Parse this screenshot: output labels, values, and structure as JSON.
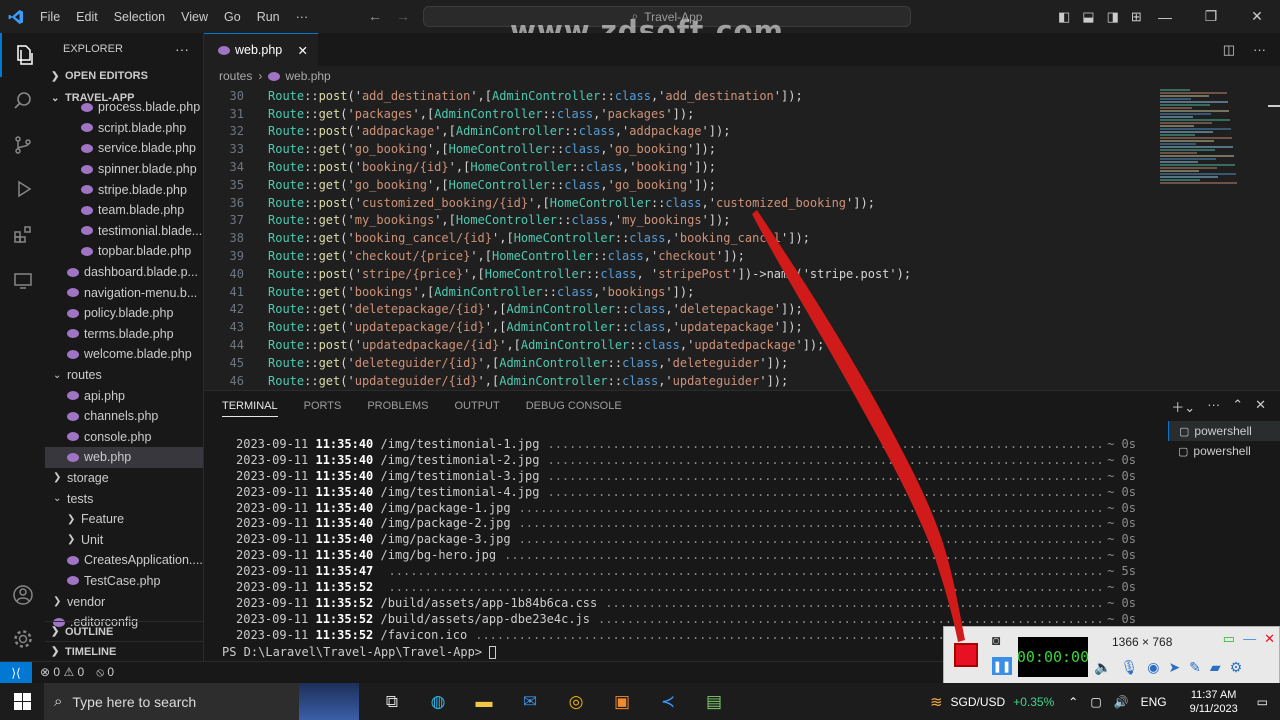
{
  "titlebar": {
    "menu": [
      "File",
      "Edit",
      "Selection",
      "View",
      "Go",
      "Run",
      "···"
    ],
    "search_text": "Travel-App",
    "watermark": "www.zdsoft.com"
  },
  "sidebar": {
    "header": "EXPLORER",
    "open_editors": "OPEN EDITORS",
    "project": "TRAVEL-APP",
    "items": [
      {
        "label": "process.blade.php",
        "indent": 2,
        "type": "file"
      },
      {
        "label": "script.blade.php",
        "indent": 2,
        "type": "file"
      },
      {
        "label": "service.blade.php",
        "indent": 2,
        "type": "file"
      },
      {
        "label": "spinner.blade.php",
        "indent": 2,
        "type": "file"
      },
      {
        "label": "stripe.blade.php",
        "indent": 2,
        "type": "file"
      },
      {
        "label": "team.blade.php",
        "indent": 2,
        "type": "file"
      },
      {
        "label": "testimonial.blade....",
        "indent": 2,
        "type": "file"
      },
      {
        "label": "topbar.blade.php",
        "indent": 2,
        "type": "file"
      },
      {
        "label": "dashboard.blade.p...",
        "indent": 1,
        "type": "file"
      },
      {
        "label": "navigation-menu.b...",
        "indent": 1,
        "type": "file"
      },
      {
        "label": "policy.blade.php",
        "indent": 1,
        "type": "file"
      },
      {
        "label": "terms.blade.php",
        "indent": 1,
        "type": "file"
      },
      {
        "label": "welcome.blade.php",
        "indent": 1,
        "type": "file"
      },
      {
        "label": "routes",
        "indent": 0,
        "type": "folder-open"
      },
      {
        "label": "api.php",
        "indent": 1,
        "type": "file"
      },
      {
        "label": "channels.php",
        "indent": 1,
        "type": "file"
      },
      {
        "label": "console.php",
        "indent": 1,
        "type": "file"
      },
      {
        "label": "web.php",
        "indent": 1,
        "type": "file",
        "selected": true
      },
      {
        "label": "storage",
        "indent": 0,
        "type": "folder"
      },
      {
        "label": "tests",
        "indent": 0,
        "type": "folder-open"
      },
      {
        "label": "Feature",
        "indent": 1,
        "type": "folder"
      },
      {
        "label": "Unit",
        "indent": 1,
        "type": "folder"
      },
      {
        "label": "CreatesApplication....",
        "indent": 1,
        "type": "file"
      },
      {
        "label": "TestCase.php",
        "indent": 1,
        "type": "file"
      },
      {
        "label": "vendor",
        "indent": 0,
        "type": "folder"
      },
      {
        "label": ".editorconfig",
        "indent": 0,
        "type": "file"
      }
    ],
    "outline": "OUTLINE",
    "timeline": "TIMELINE"
  },
  "editor": {
    "tab_label": "web.php",
    "breadcrumb": [
      "routes",
      "web.php"
    ],
    "lines": [
      {
        "n": "30",
        "m": "post",
        "path": "add_destination",
        "ctl": "AdminController",
        "act": "add_destination",
        "tail": "]);"
      },
      {
        "n": "31",
        "m": "get",
        "path": "packages",
        "ctl": "AdminController",
        "act": "packages",
        "tail": "]);"
      },
      {
        "n": "32",
        "m": "post",
        "path": "addpackage",
        "ctl": "AdminController",
        "act": "addpackage",
        "tail": "]);"
      },
      {
        "n": "33",
        "m": "get",
        "path": "go_booking",
        "ctl": "HomeController",
        "act": "go_booking",
        "tail": "]);"
      },
      {
        "n": "34",
        "m": "post",
        "path": "booking/{id}",
        "ctl": "HomeController",
        "act": "booking",
        "tail": "]);"
      },
      {
        "n": "35",
        "m": "get",
        "path": "go_booking",
        "ctl": "HomeController",
        "act": "go_booking",
        "tail": "]);"
      },
      {
        "n": "36",
        "m": "post",
        "path": "customized_booking/{id}",
        "ctl": "HomeController",
        "act": "customized_booking",
        "tail": "]);"
      },
      {
        "n": "37",
        "m": "get",
        "path": "my_bookings",
        "ctl": "HomeController",
        "act": "my_bookings",
        "tail": "]);"
      },
      {
        "n": "38",
        "m": "get",
        "path": "booking_cancel/{id}",
        "ctl": "HomeController",
        "act": "booking_cancel",
        "tail": "]);"
      },
      {
        "n": "39",
        "m": "get",
        "path": "checkout/{price}",
        "ctl": "HomeController",
        "act": "checkout",
        "tail": "]);"
      },
      {
        "n": "40",
        "m": "post",
        "path": "stripe/{price}",
        "ctl": "HomeController",
        "act": "stripePost",
        "tail": "])->name('stripe.post');",
        "space": true
      },
      {
        "n": "41",
        "m": "get",
        "path": "bookings",
        "ctl": "AdminController",
        "act": "bookings",
        "tail": "]);"
      },
      {
        "n": "42",
        "m": "get",
        "path": "deletepackage/{id}",
        "ctl": "AdminController",
        "act": "deletepackage",
        "tail": "]);"
      },
      {
        "n": "43",
        "m": "get",
        "path": "updatepackage/{id}",
        "ctl": "AdminController",
        "act": "updatepackage",
        "tail": "]);"
      },
      {
        "n": "44",
        "m": "post",
        "path": "updatedpackage/{id}",
        "ctl": "AdminController",
        "act": "updatedpackage",
        "tail": "]);"
      },
      {
        "n": "45",
        "m": "get",
        "path": "deleteguider/{id}",
        "ctl": "AdminController",
        "act": "deleteguider",
        "tail": "]);"
      },
      {
        "n": "46",
        "m": "get",
        "path": "updateguider/{id}",
        "ctl": "AdminController",
        "act": "updateguider",
        "tail": "]);"
      }
    ]
  },
  "panel": {
    "tabs": [
      "TERMINAL",
      "PORTS",
      "PROBLEMS",
      "OUTPUT",
      "DEBUG CONSOLE"
    ],
    "log": [
      {
        "date": "2023-09-11",
        "time": "11:35:40",
        "path": "/img/testimonial-1.jpg",
        "dur": "~ 0s"
      },
      {
        "date": "2023-09-11",
        "time": "11:35:40",
        "path": "/img/testimonial-2.jpg",
        "dur": "~ 0s"
      },
      {
        "date": "2023-09-11",
        "time": "11:35:40",
        "path": "/img/testimonial-3.jpg",
        "dur": "~ 0s"
      },
      {
        "date": "2023-09-11",
        "time": "11:35:40",
        "path": "/img/testimonial-4.jpg",
        "dur": "~ 0s"
      },
      {
        "date": "2023-09-11",
        "time": "11:35:40",
        "path": "/img/package-1.jpg",
        "dur": "~ 0s"
      },
      {
        "date": "2023-09-11",
        "time": "11:35:40",
        "path": "/img/package-2.jpg",
        "dur": "~ 0s"
      },
      {
        "date": "2023-09-11",
        "time": "11:35:40",
        "path": "/img/package-3.jpg",
        "dur": "~ 0s"
      },
      {
        "date": "2023-09-11",
        "time": "11:35:40",
        "path": "/img/bg-hero.jpg",
        "dur": "~ 0s"
      },
      {
        "date": "2023-09-11",
        "time": "11:35:47",
        "path": "",
        "dur": "~ 5s"
      },
      {
        "date": "2023-09-11",
        "time": "11:35:52",
        "path": "",
        "dur": "~ 0s"
      },
      {
        "date": "2023-09-11",
        "time": "11:35:52",
        "path": "/build/assets/app-1b84b6ca.css",
        "dur": "~ 0s"
      },
      {
        "date": "2023-09-11",
        "time": "11:35:52",
        "path": "/build/assets/app-dbe23e4c.js",
        "dur": "~ 0s"
      },
      {
        "date": "2023-09-11",
        "time": "11:35:52",
        "path": "/favicon.ico",
        "dur": "~ 0s"
      }
    ],
    "prompt": "PS D:\\Laravel\\Travel-App\\Travel-App> ",
    "terminals": [
      "powershell",
      "powershell"
    ]
  },
  "statusbar": {
    "errors": "0",
    "warnings": "0",
    "ports": "0"
  },
  "recorder": {
    "timer": "00:00:00",
    "resolution": "1366 × 768"
  },
  "taskbar": {
    "search_placeholder": "Type here to search",
    "fx_pair": "SGD/USD",
    "fx_change": "+0.35%",
    "lang": "ENG",
    "time": "11:37 AM",
    "date": "9/11/2023"
  },
  "colors": {
    "accent": "#0078d4",
    "php_icon": "#a074c4",
    "annotation": "#d11a1a"
  }
}
